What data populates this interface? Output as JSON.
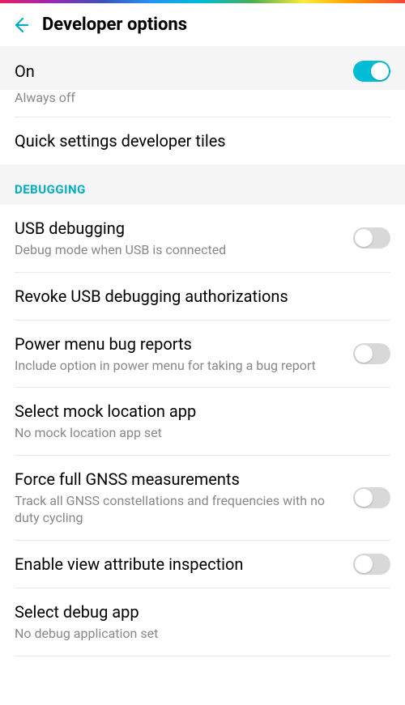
{
  "header": {
    "title": "Developer options"
  },
  "main_toggle": {
    "label": "On",
    "on": true
  },
  "cutoff_item": {
    "subtitle": "Always off"
  },
  "quick_tiles": {
    "title": "Quick settings developer tiles"
  },
  "section_debugging": "DEBUGGING",
  "usb_debugging": {
    "title": "USB debugging",
    "subtitle": "Debug mode when USB is connected",
    "on": false
  },
  "revoke_usb": {
    "title": "Revoke USB debugging authorizations"
  },
  "power_menu": {
    "title": "Power menu bug reports",
    "subtitle": "Include option in power menu for taking a bug report",
    "on": false
  },
  "mock_location": {
    "title": "Select mock location app",
    "subtitle": "No mock location app set"
  },
  "gnss": {
    "title": "Force full GNSS measurements",
    "subtitle": "Track all GNSS constellations and frequencies with no duty cycling",
    "on": false
  },
  "view_attribute": {
    "title": "Enable view attribute inspection",
    "on": false
  },
  "debug_app": {
    "title": "Select debug app",
    "subtitle": "No debug application set"
  }
}
